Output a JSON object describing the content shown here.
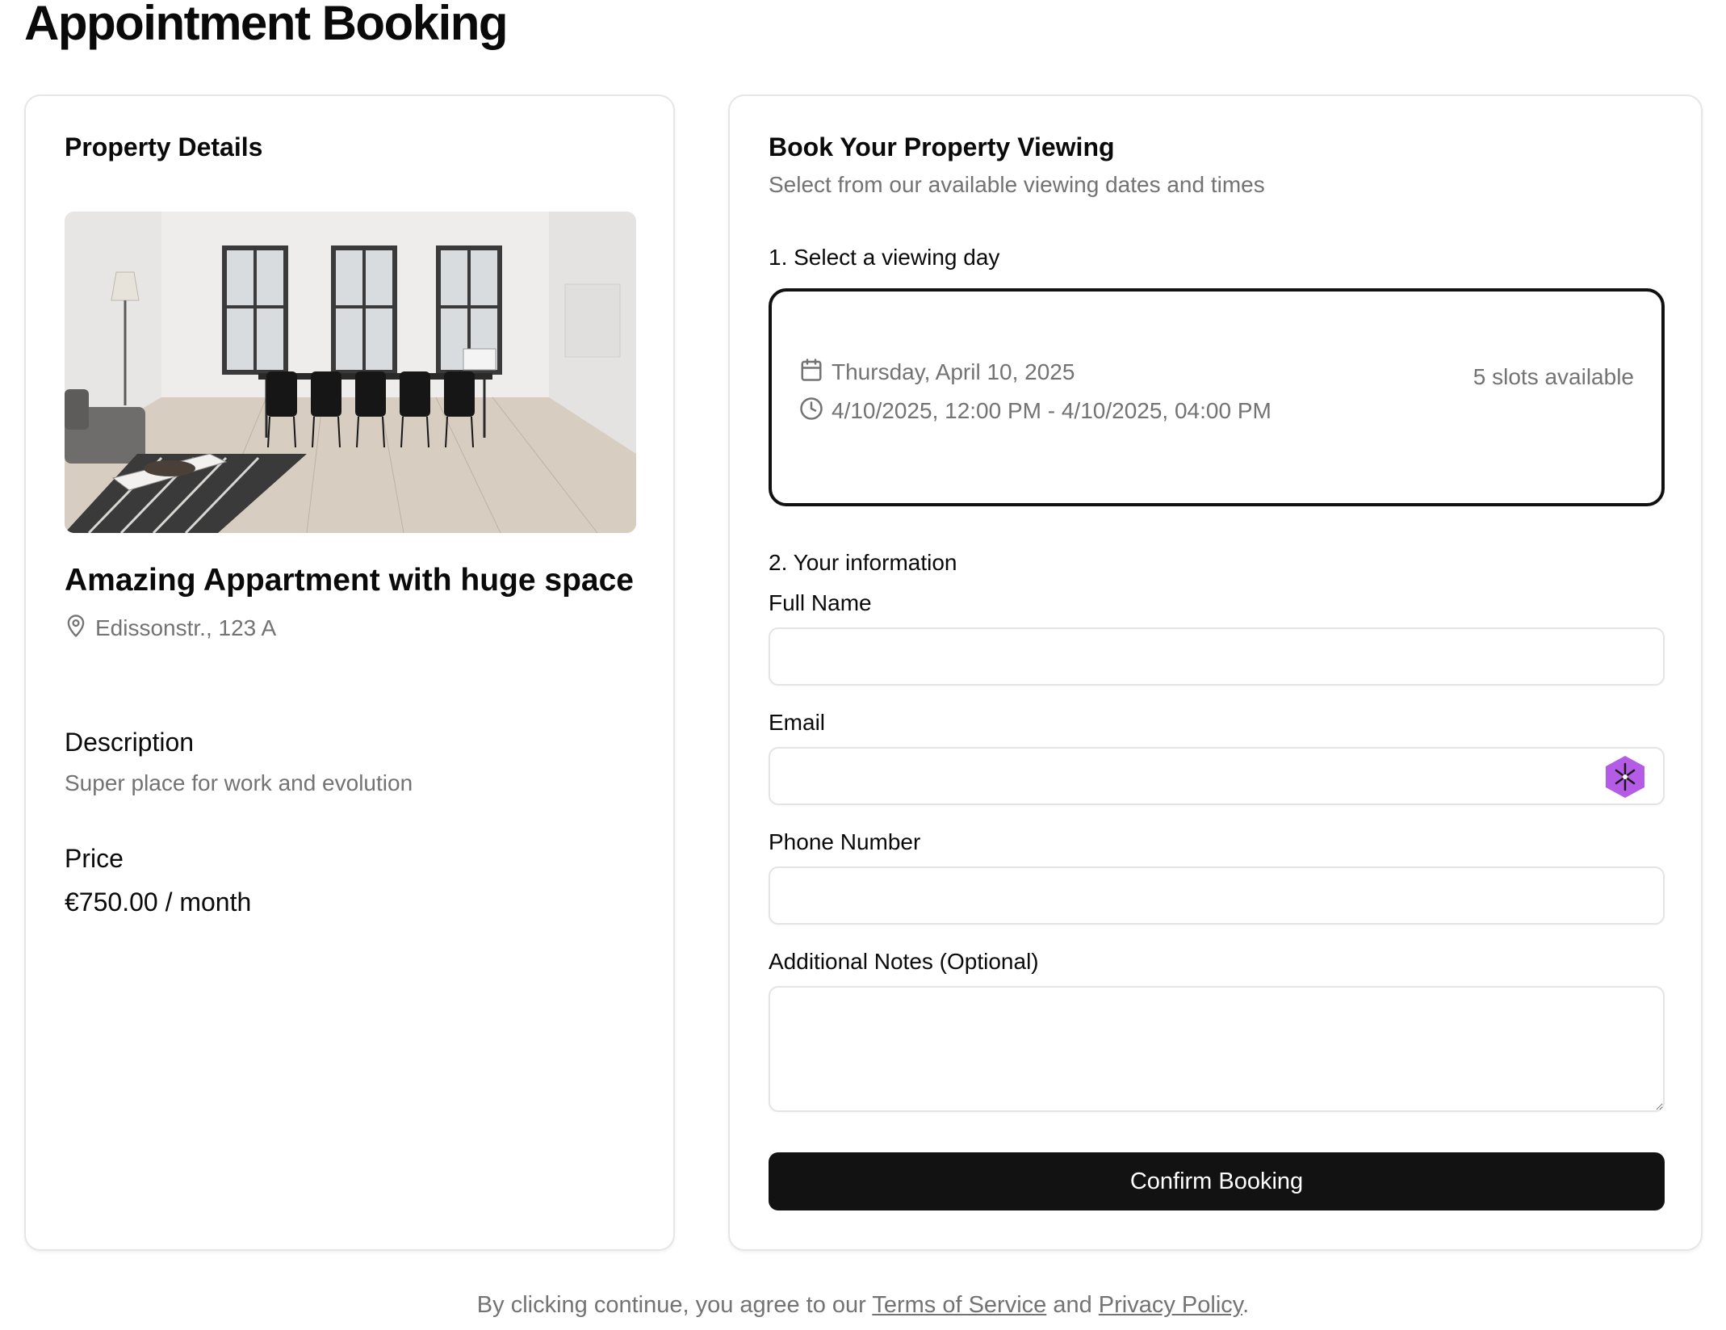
{
  "page": {
    "title": "Appointment Booking"
  },
  "property": {
    "card_title": "Property Details",
    "name": "Amazing Appartment with huge space",
    "address": "Edissonstr., 123 A",
    "description_heading": "Description",
    "description": "Super place for work and evolution",
    "price_heading": "Price",
    "price": "€750.00 / month"
  },
  "booking": {
    "title": "Book Your Property Viewing",
    "subtitle": "Select from our available viewing dates and times",
    "step1_label": "1. Select a viewing day",
    "slot": {
      "date": "Thursday, April 10, 2025",
      "time_range": "4/10/2025, 12:00 PM - 4/10/2025, 04:00 PM",
      "availability": "5 slots available"
    },
    "step2_label": "2. Your information",
    "fields": {
      "full_name_label": "Full Name",
      "full_name_value": "",
      "email_label": "Email",
      "email_value": "",
      "phone_label": "Phone Number",
      "phone_value": "",
      "notes_label": "Additional Notes (Optional)",
      "notes_value": ""
    },
    "confirm_label": "Confirm Booking"
  },
  "footer": {
    "prefix": "By clicking continue, you agree to our ",
    "terms": "Terms of Service",
    "middle": " and ",
    "privacy": "Privacy Policy",
    "suffix": "."
  },
  "icons": {
    "location": "map-pin-icon",
    "calendar": "calendar-icon",
    "clock": "clock-icon",
    "extension": "password-manager-extension-icon"
  },
  "colors": {
    "primary_button": "#121212",
    "muted_text": "#737373",
    "extension_icon": "#b45ce6"
  }
}
